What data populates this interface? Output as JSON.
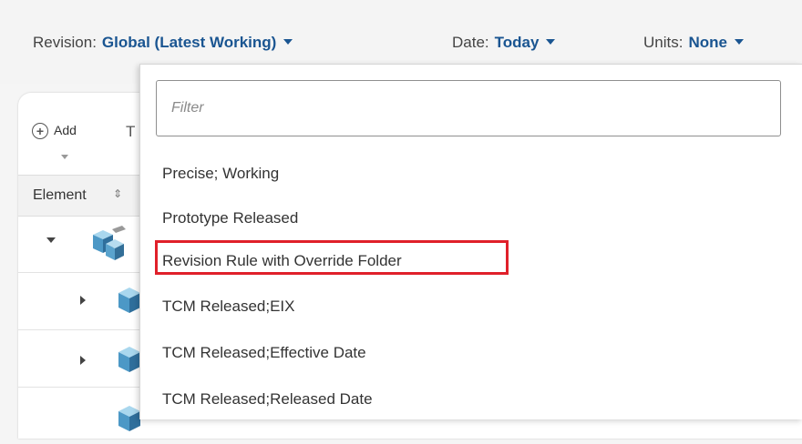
{
  "topbar": {
    "revision_label": "Revision:",
    "revision_value": "Global (Latest Working)",
    "date_label": "Date:",
    "date_value": "Today",
    "units_label": "Units:",
    "units_value": "None"
  },
  "toolbar": {
    "add_label": "Add",
    "truncated_glyph": "T"
  },
  "table": {
    "column_header": "Element",
    "sort_glyph": "⇕"
  },
  "dropdown": {
    "filter_placeholder": "Filter",
    "options": [
      "Precise; Working",
      "Prototype Released",
      "Revision Rule with Override Folder",
      "TCM Released;EIX",
      "TCM Released;Effective Date",
      "TCM Released;Released Date"
    ],
    "highlighted_index": 2,
    "highlight_color": "#e0202a"
  },
  "colors": {
    "link_blue": "#1a5591",
    "background": "#f4f4f4"
  }
}
